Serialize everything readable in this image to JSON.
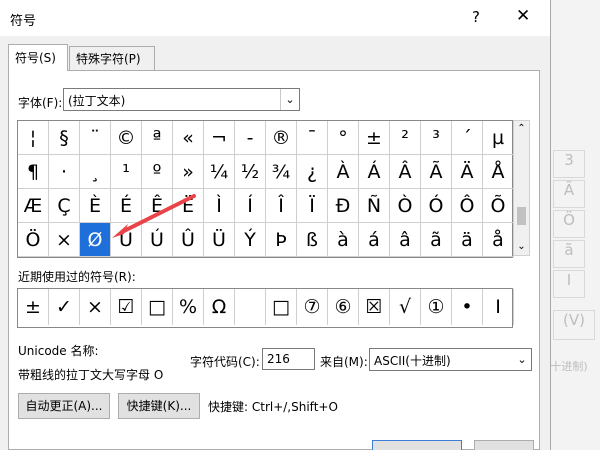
{
  "background_doc": {
    "glyphs": [
      "3",
      "Ã",
      "Ö",
      "ã",
      "I",
      "(V)",
      "十进制)"
    ]
  },
  "dialog": {
    "title": "符号",
    "help_glyph": "?",
    "close_glyph": "✕",
    "tabs": [
      {
        "label": "符号(S)",
        "active": true
      },
      {
        "label": "特殊字符(P)",
        "active": false
      }
    ],
    "font_label": "字体(F):",
    "font_value": "(拉丁文本)",
    "dropdown_glyph": "⌄",
    "symbols": [
      [
        "¦",
        "§",
        "¨",
        "©",
        "ª",
        "«",
        "¬",
        "-",
        "®",
        "¯",
        "°",
        "±",
        "²",
        "³",
        "´",
        "µ"
      ],
      [
        "¶",
        "·",
        "¸",
        "¹",
        "º",
        "»",
        "¼",
        "½",
        "¾",
        "¿",
        "À",
        "Á",
        "Â",
        "Ã",
        "Ä",
        "Å"
      ],
      [
        "Æ",
        "Ç",
        "È",
        "É",
        "Ê",
        "Ë",
        "Ì",
        "Í",
        "Î",
        "Ï",
        "Ð",
        "Ñ",
        "Ò",
        "Ó",
        "Ô",
        "Õ"
      ],
      [
        "Ö",
        "×",
        "Ø",
        "Ù",
        "Ú",
        "Û",
        "Ü",
        "Ý",
        "Þ",
        "ß",
        "à",
        "á",
        "â",
        "ã",
        "ä",
        "å"
      ]
    ],
    "selected_symbol": "Ø",
    "scroll_up": "⌃",
    "scroll_down": "⌄",
    "recent_label": "近期使用过的符号(R):",
    "recent_symbols": [
      "±",
      "✓",
      "×",
      "☑",
      "□",
      "%",
      "Ω",
      "",
      "□",
      "⑦",
      "⑥",
      "☒",
      "√",
      "①",
      "•",
      "Ⅰ"
    ],
    "unicode_name_label": "Unicode 名称:",
    "unicode_name_value": "带粗线的拉丁文大写字母 O",
    "char_code_label": "字符代码(C):",
    "char_code_value": "216",
    "from_label": "来自(M):",
    "from_value": "ASCII(十进制)",
    "autocorrect_button": "自动更正(A)...",
    "shortcut_button": "快捷键(K)...",
    "shortcut_text": "快捷键: Ctrl+/,Shift+O"
  },
  "colors": {
    "selection": "#1e6fd9",
    "arrow": "#e8454a"
  }
}
